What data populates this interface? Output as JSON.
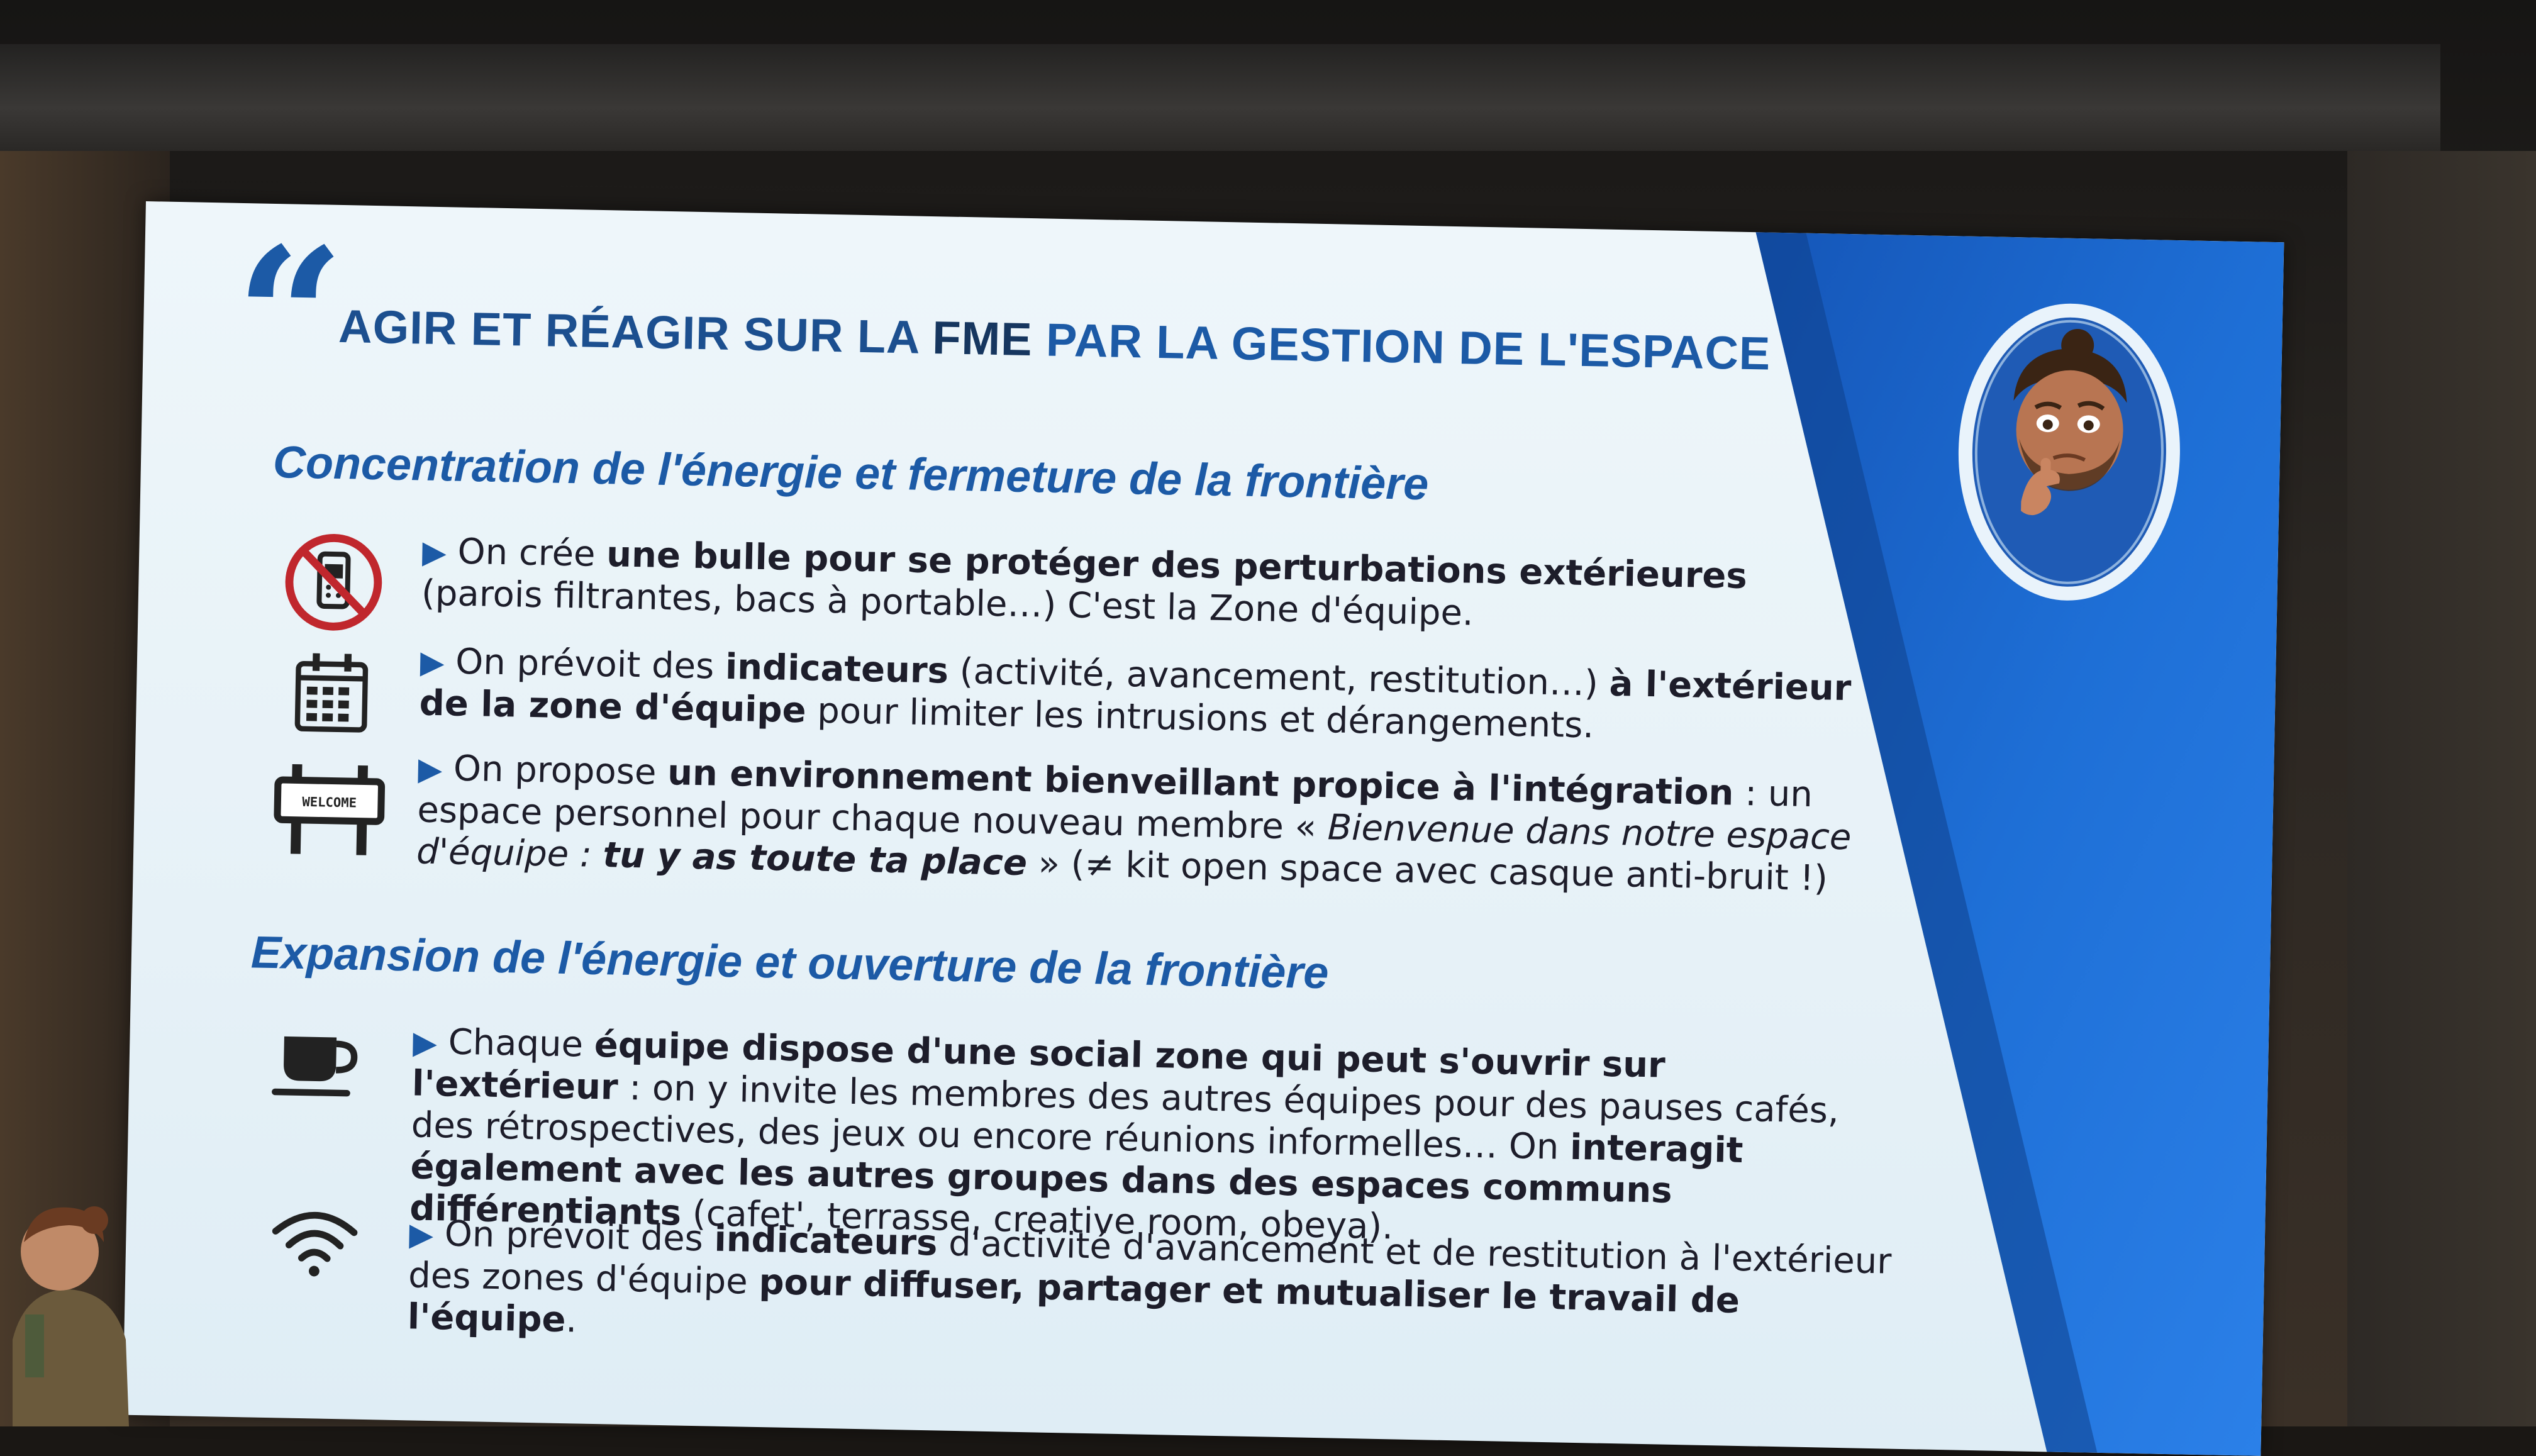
{
  "slide": {
    "title_part1": "AGIR ET RÉAGIR SUR LA ",
    "title_part2": "FME",
    "title_part3": " PAR LA GESTION DE L'ESPACE",
    "quote_mark": "“",
    "section1": {
      "heading": "Concentration de l'énergie et fermeture de la frontière",
      "bullets": [
        {
          "icon": "no-phone-icon",
          "t1": " On crée ",
          "b1": "une bulle pour se protéger des perturbations extérieures",
          "t2": " (parois filtrantes,  bacs à portable…) C'est la Zone d'équipe."
        },
        {
          "icon": "calendar-icon",
          "t1": " On prévoit des ",
          "b1": "indicateurs",
          "t2": " (activité, avancement, restitution…) ",
          "b2": "à l'extérieur de la zone d'équipe",
          "t3": " pour limiter les intrusions et dérangements."
        },
        {
          "icon": "welcome-sign-icon",
          "icon_text": "WELCOME",
          "t1": " On propose ",
          "b1": "un environnement bienveillant propice à l'intégration",
          "t2": " : un espace personnel pour chaque nouveau membre « ",
          "i1": "Bienvenue dans notre espace d'équipe : ",
          "bi1": "tu y as toute ta place",
          "t3": " » (≠ kit open space avec casque anti-bruit !)"
        }
      ]
    },
    "section2": {
      "heading": "Expansion de l'énergie et ouverture de la frontière",
      "bullets": [
        {
          "icon": "coffee-cup-icon",
          "t1": " Chaque ",
          "b1": "équipe dispose d'une social zone qui peut s'ouvrir sur l'extérieur",
          "t2": " :  on y invite les membres des autres équipes pour des pauses cafés, des rétrospectives, des jeux ou encore réunions informelles… On ",
          "b2": "interagit également avec les autres groupes dans des espaces communs différentiants",
          "t3": " (cafet', terrasse, creative room, obeya)."
        },
        {
          "icon": "wifi-icon",
          "t1": " On prévoit des ",
          "b1": "indicateurs",
          "t2": " d'activité d'avancement et de restitution à l'extérieur des zones d'équipe ",
          "b2": "pour diffuser, partager et mutualiser le travail de l'équipe",
          "t3": "."
        }
      ]
    },
    "bullet_marker": "▶",
    "avatar_icon": "thinking-avatar-icon",
    "colors": {
      "accent": "#1c5aa6",
      "title": "#1c4f8f",
      "panel": "#1e6fd6",
      "background": "#e8f2f8"
    }
  }
}
